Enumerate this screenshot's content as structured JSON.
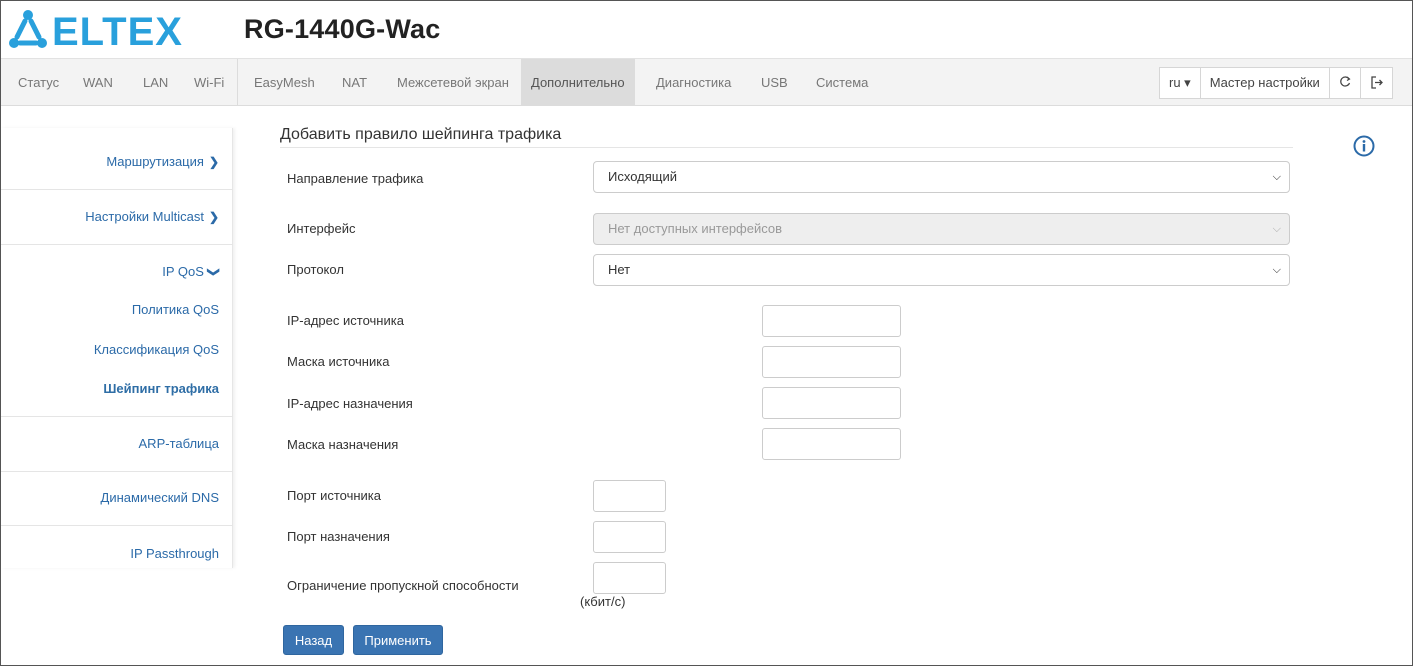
{
  "header": {
    "brand": "ELTEX",
    "model": "RG-1440G-Wac"
  },
  "colors": {
    "brand_blue": "#29a0dc",
    "link": "#2b6aa8",
    "button": "#3a74b2"
  },
  "nav": {
    "items": [
      "Статус",
      "WAN",
      "LAN",
      "Wi-Fi",
      "EasyMesh",
      "NAT",
      "Межсетевой экран",
      "Дополнительно",
      "Диагностика",
      "USB",
      "Система"
    ],
    "active": "Дополнительно",
    "language": "ru ▾",
    "wizard": "Мастер настройки",
    "refresh_icon": "refresh-icon",
    "logout_icon": "logout-icon"
  },
  "sidebar": {
    "routing": "Маршрутизация",
    "multicast": "Настройки Multicast",
    "ipqos": "IP QoS",
    "qos_policy": "Политика QoS",
    "qos_class": "Классификация QoS",
    "shaping": "Шейпинг трафика",
    "arp": "ARP-таблица",
    "ddns": "Динамический DNS",
    "passthrough": "IP Passthrough"
  },
  "form": {
    "title": "Добавить правило шейпинга трафика",
    "direction_label": "Направление трафика",
    "direction_value": "Исходящий",
    "interface_label": "Интерфейс",
    "interface_value": "Нет доступных интерфейсов",
    "protocol_label": "Протокол",
    "protocol_value": "Нет",
    "src_ip_label": "IP-адрес источника",
    "src_mask_label": "Маска источника",
    "dst_ip_label": "IP-адрес назначения",
    "dst_mask_label": "Маска назначения",
    "src_port_label": "Порт источника",
    "dst_port_label": "Порт назначения",
    "bandwidth_label": "Ограничение пропускной способности",
    "bandwidth_unit": "(кбит/с)",
    "back_button": "Назад",
    "apply_button": "Применить"
  }
}
